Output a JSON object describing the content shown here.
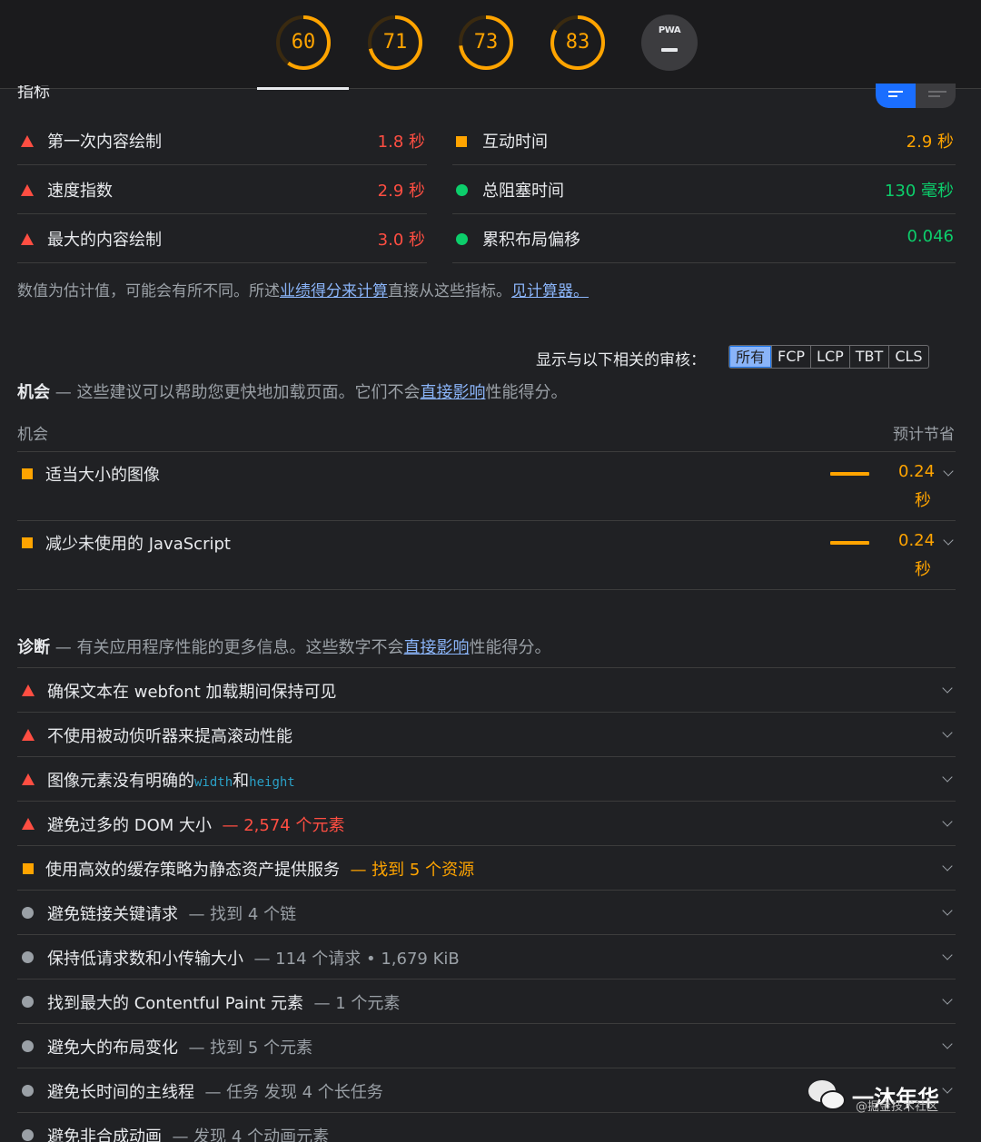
{
  "gauges": [
    {
      "score": "60",
      "color": "#ffa400",
      "pct": 0.6
    },
    {
      "score": "71",
      "color": "#ffa400",
      "pct": 0.71
    },
    {
      "score": "73",
      "color": "#ffa400",
      "pct": 0.73
    },
    {
      "score": "83",
      "color": "#ffa400",
      "pct": 0.83
    }
  ],
  "pwa": {
    "label": "PWA",
    "value": "—"
  },
  "metrics_title": "指标",
  "metrics_left": [
    {
      "icon": "red-triangle-icon",
      "label": "第一次内容绘制",
      "value": "1.8 秒",
      "status": "red"
    },
    {
      "icon": "red-triangle-icon",
      "label": "速度指数",
      "value": "2.9 秒",
      "status": "red"
    },
    {
      "icon": "red-triangle-icon",
      "label": "最大的内容绘制",
      "value": "3.0 秒",
      "status": "red"
    }
  ],
  "metrics_right": [
    {
      "icon": "orange-square-icon",
      "label": "互动时间",
      "value": "2.9 秒",
      "status": "orange"
    },
    {
      "icon": "green-circle-icon",
      "label": "总阻塞时间",
      "value": "130 毫秒",
      "status": "green"
    },
    {
      "icon": "green-circle-icon",
      "label": "累积布局偏移",
      "value": "0.046",
      "status": "green"
    }
  ],
  "note": {
    "prefix": "数值为估计值，可能会有所不同。所述",
    "link1": "业绩得分来计算",
    "middle": "直接从这些指标。",
    "link2": "见计算器。"
  },
  "filter": {
    "label": "显示与以下相关的审核：",
    "options": [
      "所有",
      "FCP",
      "LCP",
      "TBT",
      "CLS"
    ],
    "selected": "所有"
  },
  "opportunities": {
    "title": "机会",
    "desc_prefix": " — 这些建议可以帮助您更快地加载页面。它们不会",
    "desc_link": "直接影响",
    "desc_suffix": "性能得分。",
    "col_left": "机会",
    "col_right": "预计节省",
    "items": [
      {
        "label": "适当大小的图像",
        "savings_value": "0.24",
        "savings_unit": "秒"
      },
      {
        "label": "减少未使用的 JavaScript",
        "savings_value": "0.24",
        "savings_unit": "秒"
      }
    ]
  },
  "diagnostics": {
    "title": "诊断",
    "desc_prefix": " — 有关应用程序性能的更多信息。这些数字不会",
    "desc_link": "直接影响",
    "desc_suffix": "性能得分。",
    "items": [
      {
        "icon": "red-triangle-icon",
        "label": "确保文本在 webfont 加载期间保持可见",
        "detail": "",
        "detail_status": ""
      },
      {
        "icon": "red-triangle-icon",
        "label": "不使用被动侦听器来提高滚动性能",
        "detail": "",
        "detail_status": ""
      },
      {
        "icon": "red-triangle-icon",
        "label": "图像元素没有明确的",
        "code1": "width",
        "mid": "和",
        "code2": "height",
        "detail": "",
        "detail_status": ""
      },
      {
        "icon": "red-triangle-icon",
        "label": "避免过多的 DOM 大小",
        "detail": "— 2,574 个元素",
        "detail_status": "red"
      },
      {
        "icon": "orange-square-icon",
        "label": "使用高效的缓存策略为静态资产提供服务",
        "detail": "— 找到 5 个资源",
        "detail_status": "orange"
      },
      {
        "icon": "gray-circle-icon",
        "label": "避免链接关键请求",
        "detail": "— 找到 4 个链",
        "detail_status": "muted"
      },
      {
        "icon": "gray-circle-icon",
        "label": "保持低请求数和小传输大小",
        "detail": "— 114 个请求 • 1,679 KiB",
        "detail_status": "muted"
      },
      {
        "icon": "gray-circle-icon",
        "label": "找到最大的 Contentful Paint 元素",
        "detail": "— 1 个元素",
        "detail_status": "muted"
      },
      {
        "icon": "gray-circle-icon",
        "label": "避免大的布局变化",
        "detail": "— 找到 5 个元素",
        "detail_status": "muted"
      },
      {
        "icon": "gray-circle-icon",
        "label": "避免长时间的主线程",
        "detail": "— 任务 发现 4 个长任务",
        "detail_status": "muted"
      },
      {
        "icon": "gray-circle-icon",
        "label": "避免非合成动画",
        "detail": "— 发现 4 个动画元素",
        "detail_status": "muted"
      }
    ]
  },
  "watermark": {
    "name": "一沐年华",
    "sub": "@掘金技术社区"
  }
}
